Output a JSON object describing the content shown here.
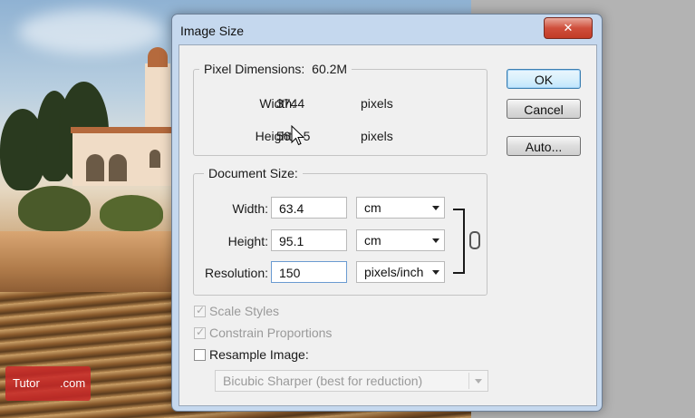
{
  "window": {
    "title": "Image Size",
    "close_glyph": "✕"
  },
  "pixel_dimensions": {
    "legend": "Pixel Dimensions:",
    "size": "60.2M",
    "width_label": "Width:",
    "width_value": "3744",
    "width_unit": "pixels",
    "height_label": "Height:",
    "height_value": "56",
    "height_value_tail": "5",
    "height_unit": "pixels"
  },
  "document_size": {
    "legend": "Document Size:",
    "width_label": "Width:",
    "width_value": "63.4",
    "width_unit": "cm",
    "height_label": "Height:",
    "height_value": "95.1",
    "height_unit": "cm",
    "resolution_label": "Resolution:",
    "resolution_value": "150",
    "resolution_unit": "pixels/inch"
  },
  "buttons": {
    "ok": "OK",
    "cancel": "Cancel",
    "auto": "Auto..."
  },
  "options": {
    "scale_styles": {
      "label": "Scale Styles",
      "checked": true,
      "enabled": false
    },
    "constrain_proportions": {
      "label": "Constrain Proportions",
      "checked": true,
      "enabled": false
    },
    "resample_image": {
      "label": "Resample Image:",
      "checked": false,
      "enabled": true
    },
    "resample_method": "Bicubic Sharper (best for reduction)"
  },
  "watermark": {
    "left": "Tutor",
    "right": ".com"
  },
  "icons": {
    "link": "chain-link-icon",
    "cursor": "mouse-pointer-icon"
  },
  "colors": {
    "dialog_frame": "#c5d8ee",
    "close_button": "#c8402a",
    "watermark": "#c82828"
  }
}
